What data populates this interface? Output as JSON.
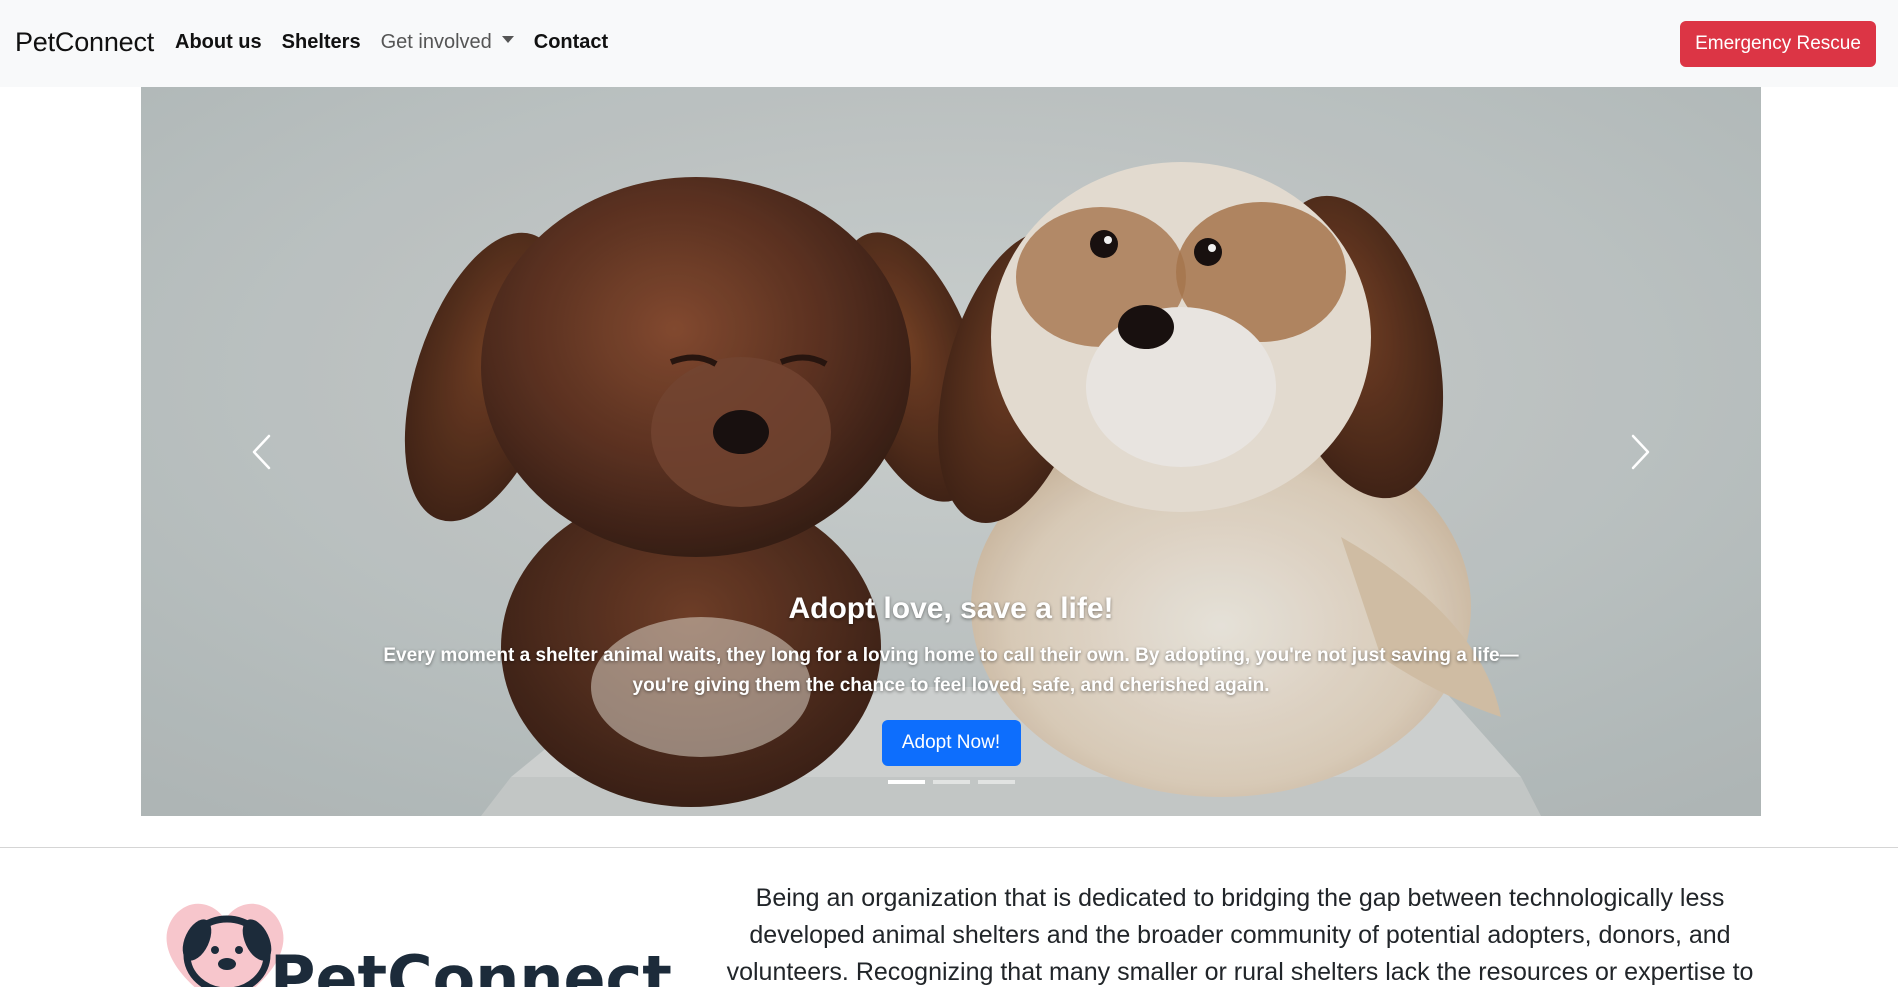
{
  "navbar": {
    "brand": "PetConnect",
    "links": [
      "About us",
      "Shelters",
      "Get involved",
      "Contact"
    ],
    "emergency_label": "Emergency Rescue"
  },
  "carousel": {
    "title": "Adopt love, save a life!",
    "text": "Every moment a shelter animal waits, they long for a loving home to call their own. By adopting, you're not just saving a life—you're giving them the chance to feel loved, safe, and cherished again.",
    "button_label": "Adopt Now!",
    "slide_count": 3,
    "active_slide": 1,
    "prev_icon": "chevron-left-icon",
    "next_icon": "chevron-right-icon"
  },
  "about": {
    "logo_text": "PetConnect",
    "text": "Being an organization that is dedicated to bridging the gap between technologically less developed animal shelters and the broader community of potential adopters, donors, and volunteers. Recognizing that many smaller or rural shelters lack the resources or expertise to"
  },
  "colors": {
    "navbar_bg": "#f8f9fa",
    "emergency": "#dc3545",
    "primary": "#0d6efd",
    "logo_heart": "#f7c6cc",
    "logo_dark": "#1c2b3a"
  }
}
